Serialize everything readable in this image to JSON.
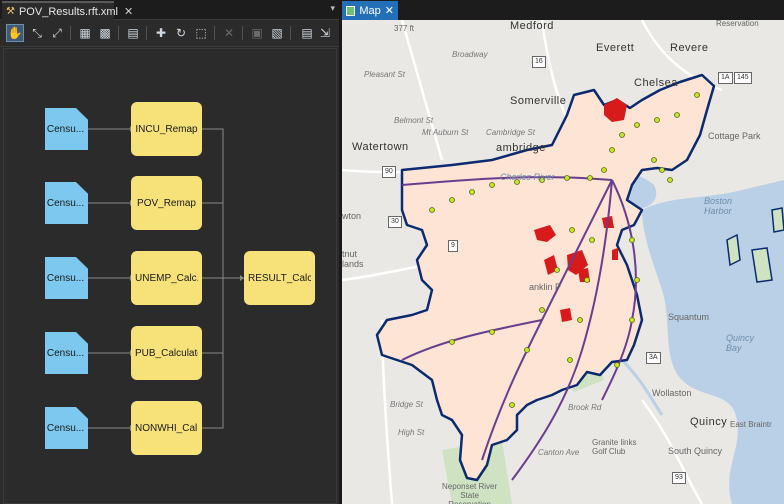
{
  "left_tab": {
    "title": "POV_Results.rft.xml",
    "close": "✕",
    "menu": "▾"
  },
  "toolbar": {
    "pan": "✋",
    "fit": "⤡",
    "expand": "⤢",
    "layout": "▦",
    "arrange": "▩",
    "properties": "▤",
    "add_data": "✚",
    "refresh": "↻",
    "export": "⬚",
    "delete": "✕",
    "save": "▣",
    "save_as": "▧",
    "template": "▤",
    "overflow": "⇲"
  },
  "nodes": {
    "rasters": [
      "Censu...",
      "Censu...",
      "Censu...",
      "Censu...",
      "Censu..."
    ],
    "functions": [
      "INCU_Remap",
      "POV_Remap",
      "UNEMP_Calc...",
      "PUB_Calculator",
      "NONWHI_Cal..."
    ],
    "result": "RESULT_Calc..."
  },
  "map_tab": {
    "title": "Map",
    "close": "✕"
  },
  "map_labels": {
    "medford": "Medford",
    "everett": "Everett",
    "revere": "Revere",
    "chelsea": "Chelsea",
    "somerville": "Somerville",
    "cottage_park": "Cottage Park",
    "watertown": "Watertown",
    "cambridge": "ambridge",
    "charles": "Charles River",
    "boston_harbor": "Boston\nHarbor",
    "newton": "wton",
    "chestnut": "tnut\nlands",
    "squantum": "Squantum",
    "quincy_bay": "Quincy\nBay",
    "wollaston": "Wollaston",
    "quincy": "Quincy",
    "south_quincy": "South Quincy",
    "granite": "Granite links\nGolf Club",
    "neponset": "Neponset River\nState\nReservation",
    "franklin": "anklin P",
    "belmont": "Belmont St",
    "mt_auburn": "Mt Auburn St",
    "cambridge_st": "Cambridge St",
    "broadway": "Broadway",
    "pleasant": "Pleasant St",
    "brook_rd": "Brook Rd",
    "canton": "Canton Ave",
    "bridge_st": "Bridge St",
    "high_st": "High St",
    "reservation": "Reservation",
    "east_braintree": "East Braintr",
    "road_377": "377 ft"
  },
  "shields": [
    "90",
    "30",
    "9",
    "1A",
    "145",
    "3A",
    "93",
    "16"
  ],
  "colors": {
    "raster_node": "#7cc8ee",
    "function_node": "#f7e27a",
    "result_fill": "#fde4d5",
    "boundary": "#0b2a6f",
    "hotspot": "#d71a1a",
    "transit_stop": "#c7e32a",
    "transit_line": "#6a3d8f",
    "water": "#b9d0e6"
  }
}
